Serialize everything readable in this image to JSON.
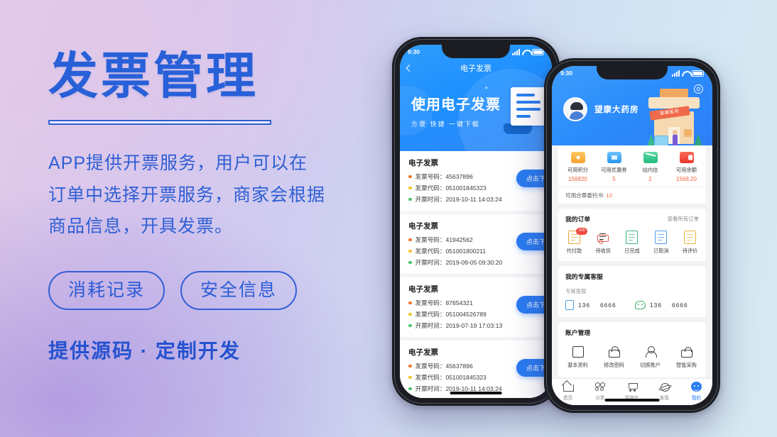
{
  "hero": {
    "title": "发票管理",
    "paragraphs": [
      "APP提供开票服务，用户可以在",
      "订单中选择开票服务，商家会根据",
      "商品信息，开具发票。"
    ],
    "pills": [
      "消耗记录",
      "安全信息"
    ],
    "tagline": "提供源码 · 定制开发",
    "accent_color": "#2860d8"
  },
  "phone_left": {
    "status": {
      "time": "9:30"
    },
    "nav": {
      "back_icon": "chevron-left-icon",
      "title": "电子发票"
    },
    "banner": {
      "title": "使用电子发票",
      "subtitle": "方便 快捷 一键下载"
    },
    "invoices": [
      {
        "card_title": "电子发票",
        "number_label": "发票号码：",
        "number": "45637896",
        "code_label": "发票代码：",
        "code": "051001845323",
        "time_label": "开票时间：",
        "time": "2019-10-11   14:03:24",
        "button": "点击下载"
      },
      {
        "card_title": "电子发票",
        "number_label": "发票号码：",
        "number": "41942562",
        "code_label": "发票代码：",
        "code": "051001800211",
        "time_label": "开票时间：",
        "time": "2019-09-05   09:30:20",
        "button": "点击下载"
      },
      {
        "card_title": "电子发票",
        "number_label": "发票号码：",
        "number": "87654321",
        "code_label": "发票代码：",
        "code": "051004526789",
        "time_label": "开票时间：",
        "time": "2019-07-19   17:03:13",
        "button": "点击下载"
      },
      {
        "card_title": "电子发票",
        "number_label": "发票号码：",
        "number": "45637896",
        "code_label": "发票代码：",
        "code": "051001845323",
        "time_label": "开票时间：",
        "time": "2019-10-11   14:03:24",
        "button": "点击下载"
      }
    ],
    "dot_colors": [
      "#f2762e",
      "#f2c32e",
      "#4cc46a"
    ]
  },
  "phone_right": {
    "status": {
      "time": "9:30"
    },
    "header": {
      "shop_name": "望康大药房",
      "settings_icon": "gear-icon",
      "shop_sign": "望康医药"
    },
    "stats": [
      {
        "icon": "coin-icon",
        "label": "可用积分",
        "value": "156820"
      },
      {
        "icon": "ticket-icon",
        "label": "可用优惠券",
        "value": "5"
      },
      {
        "icon": "mail-icon",
        "label": "站内信",
        "value": "2"
      },
      {
        "icon": "wallet-icon",
        "label": "可用余额",
        "value": "1568.20"
      }
    ],
    "stats_note_label": "可用合章委托书:",
    "stats_note_value": "10",
    "orders": {
      "title": "我的订单",
      "more": "查看所有订单",
      "items": [
        {
          "label": "代付款",
          "badge": "105"
        },
        {
          "label": "待收货",
          "badge": ""
        },
        {
          "label": "已完成",
          "badge": ""
        },
        {
          "label": "已取消",
          "badge": ""
        },
        {
          "label": "待评价",
          "badge": ""
        }
      ]
    },
    "service": {
      "title": "我的专属客服",
      "subtitle": "专属客服",
      "phone_prefix": "136",
      "phone_suffix": "6666",
      "wechat_prefix": "136",
      "wechat_suffix": "6666"
    },
    "account": {
      "title": "账户管理",
      "items": [
        {
          "label": "基本资料",
          "icon": "document-icon"
        },
        {
          "label": "修改密码",
          "icon": "lock-icon"
        },
        {
          "label": "切换账户",
          "icon": "user-switch-icon"
        },
        {
          "label": "智能采购",
          "icon": "bag-icon"
        }
      ]
    },
    "tabs": [
      {
        "label": "首页",
        "icon": "home-icon",
        "active": false
      },
      {
        "label": "分类",
        "icon": "grid-icon",
        "active": false
      },
      {
        "label": "购物车",
        "icon": "cart-icon",
        "active": false
      },
      {
        "label": "发现",
        "icon": "discover-icon",
        "active": false
      },
      {
        "label": "我的",
        "icon": "profile-icon",
        "active": true
      }
    ]
  }
}
